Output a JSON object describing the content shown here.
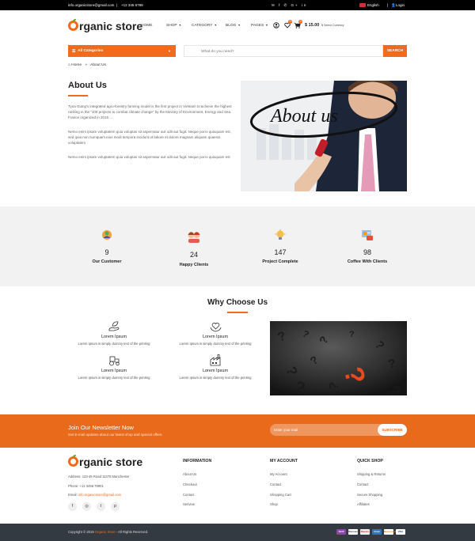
{
  "topbar": {
    "email": "info.organicstore@gmail.com",
    "separator": "|",
    "phone": "+12 345 6789",
    "language": "English",
    "login": "Login"
  },
  "header": {
    "logo_letter": "",
    "logo_text": "rganic store",
    "nav": [
      "HOME",
      "SHOP",
      "CATEGORY",
      "BLOG",
      "PAGES"
    ],
    "wishlist_count": "0",
    "cart_count": "0",
    "cart_total": "$ 15.00",
    "currency": "$ Select Currency"
  },
  "search": {
    "category_label": "All Categories",
    "placeholder": "What do you need?",
    "button": "SEARCH"
  },
  "breadcrumb": {
    "home": "Home",
    "separator": "»",
    "current": "About Us"
  },
  "about": {
    "title": "About Us",
    "para1": "Tyna Giang's integrated agro-forestry farming model is the first project in Vietnam to achieve the highest ranking in the \"100 projects to combat climate change\" by the Ministry of Environment, Energy and Sea. France organized in 2016 ...",
    "para2": "Nemo enim ipsam voluptatem quia voluptas sit aspernatur aut odit aut fugit. Neque porro quisquam est, sed quia non numquam eius modi tempora incidunt ut labore et dolore magnam aliquam quaerat voluptatem",
    "para3": "Nemo enim ipsam voluptatem quia voluptas sit aspernatur aut odit aut fugit. Neque porro quisquam est",
    "image_text": "About us"
  },
  "stats": [
    {
      "number": "9",
      "label": "Our Customer",
      "icon": "customer-icon"
    },
    {
      "number": "24",
      "label": "Happy Clients",
      "icon": "happy-clients-icon"
    },
    {
      "number": "147",
      "label": "Project Complete",
      "icon": "project-icon"
    },
    {
      "number": "98",
      "label": "Coffee With Clients",
      "icon": "coffee-icon"
    }
  ],
  "why": {
    "title": "Why Choose Us",
    "features": [
      {
        "title": "Lorem Ipsum",
        "desc": "Lorem Ipsum is simply dummy text of the printing",
        "icon": "hand-leaf-icon"
      },
      {
        "title": "Lorem Ipsum",
        "desc": "Lorem Ipsum is simply dummy text of the printing",
        "icon": "heart-hands-icon"
      },
      {
        "title": "Lorem Ipsum",
        "desc": "Lorem Ipsum is simply dummy text of the printing",
        "icon": "tractor-icon"
      },
      {
        "title": "Lorem Ipsum",
        "desc": "Lorem Ipsum is simply dummy text of the printing",
        "icon": "factory-icon"
      }
    ]
  },
  "newsletter": {
    "title": "Join Our Newsletter Now",
    "subtitle": "Get E-mail updates about our latest shop and special offers.",
    "placeholder": "Enter your mail",
    "button": "SUBSCRIBE"
  },
  "footer": {
    "address": "Address: 123-45 Road 11378 Manchester",
    "phone": "Phone: +12 3456 78901",
    "email_label": "Email:",
    "email": "info.organicstore@gmail.com",
    "columns": [
      {
        "heading": "INFORMATION",
        "links": [
          "About Us",
          "Checkout",
          "Contact",
          "Serivius"
        ]
      },
      {
        "heading": "MY ACCOUNT",
        "links": [
          "My Account",
          "Contact",
          "Shopping Cart",
          "Shop"
        ]
      },
      {
        "heading": "QUICK SHOP",
        "links": [
          "Shipping & Returns",
          "Contact",
          "Secure Shopping",
          "Affiliates"
        ]
      }
    ],
    "social": [
      "f",
      "◎",
      "t",
      "p"
    ]
  },
  "bottom": {
    "copyright_pre": "Copyright © 2019",
    "brand": "Organic Store",
    "copyright_post": "- All Rights Reserved.",
    "payments": [
      "Skrill",
      "Discover",
      "Maestro",
      "Amex",
      "Mastercard",
      "VISA"
    ]
  },
  "colors": {
    "accent": "#f26b1d",
    "dark": "#333a42"
  }
}
